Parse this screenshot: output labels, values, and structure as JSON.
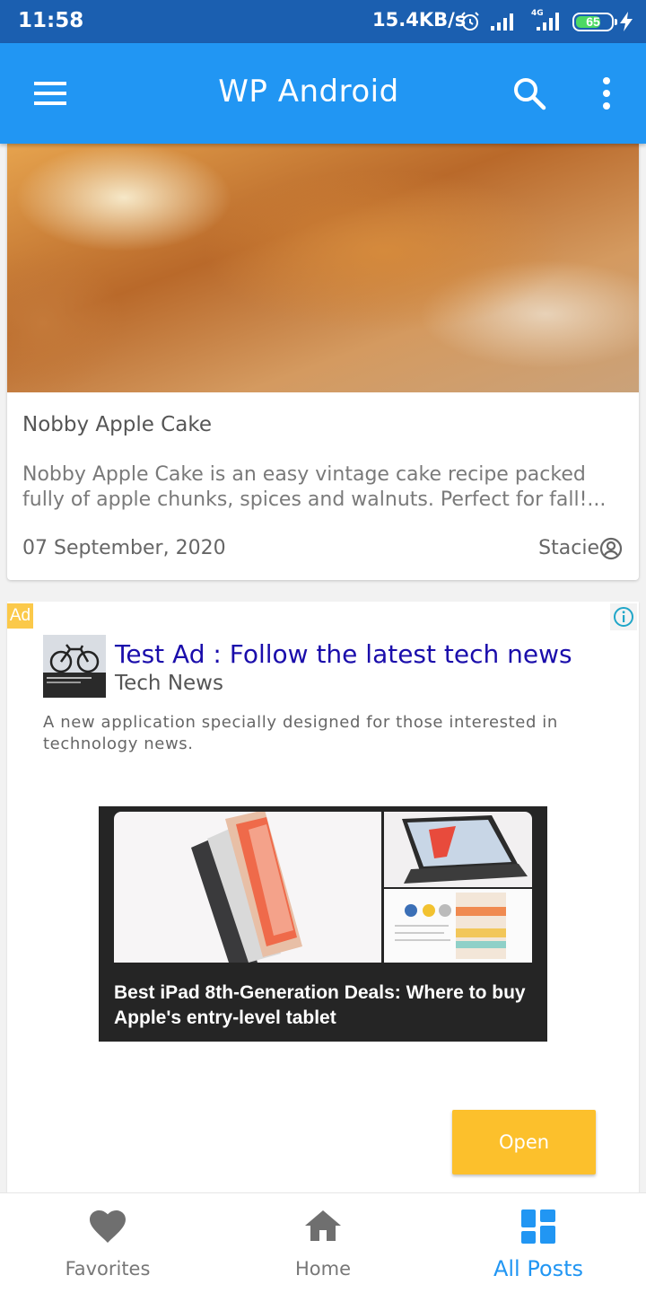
{
  "status_bar": {
    "time": "11:58",
    "network_speed": "15.4KB/s",
    "network_type": "4G",
    "battery_level": "65",
    "icons": [
      "alarm-icon",
      "signal-icon",
      "signal-4g-icon",
      "battery-icon",
      "charging-icon"
    ]
  },
  "app_bar": {
    "title": "WP Android",
    "icons": [
      "menu-icon",
      "search-icon",
      "more-vert-icon"
    ]
  },
  "post": {
    "title": "Nobby Apple Cake",
    "excerpt": "Nobby Apple Cake is an easy vintage cake recipe packed fully of apple chunks, spices and walnuts. Perfect for fall!...",
    "date": "07 September, 2020",
    "author": "Stacie"
  },
  "ad": {
    "badge": "Ad",
    "headline": "Test Ad : Follow the latest tech news",
    "advertiser": "Tech News",
    "body": "A new application specially designed for those interested in technology news.",
    "media_caption": "Best iPad 8th-Generation Deals: Where to buy Apple's entry-level tablet",
    "cta": "Open"
  },
  "bottom_nav": {
    "items": [
      {
        "label": "Favorites",
        "icon": "heart-icon"
      },
      {
        "label": "Home",
        "icon": "home-icon"
      },
      {
        "label": "All Posts",
        "icon": "dashboard-icon"
      }
    ],
    "active": "All Posts"
  },
  "colors": {
    "status_bar": "#1b5fb0",
    "app_bar": "#2196f3",
    "ad_badge": "#fbc94a",
    "ad_headline": "#1a0dab",
    "cta_button": "#fcc02c",
    "active_tab": "#2196f3"
  }
}
